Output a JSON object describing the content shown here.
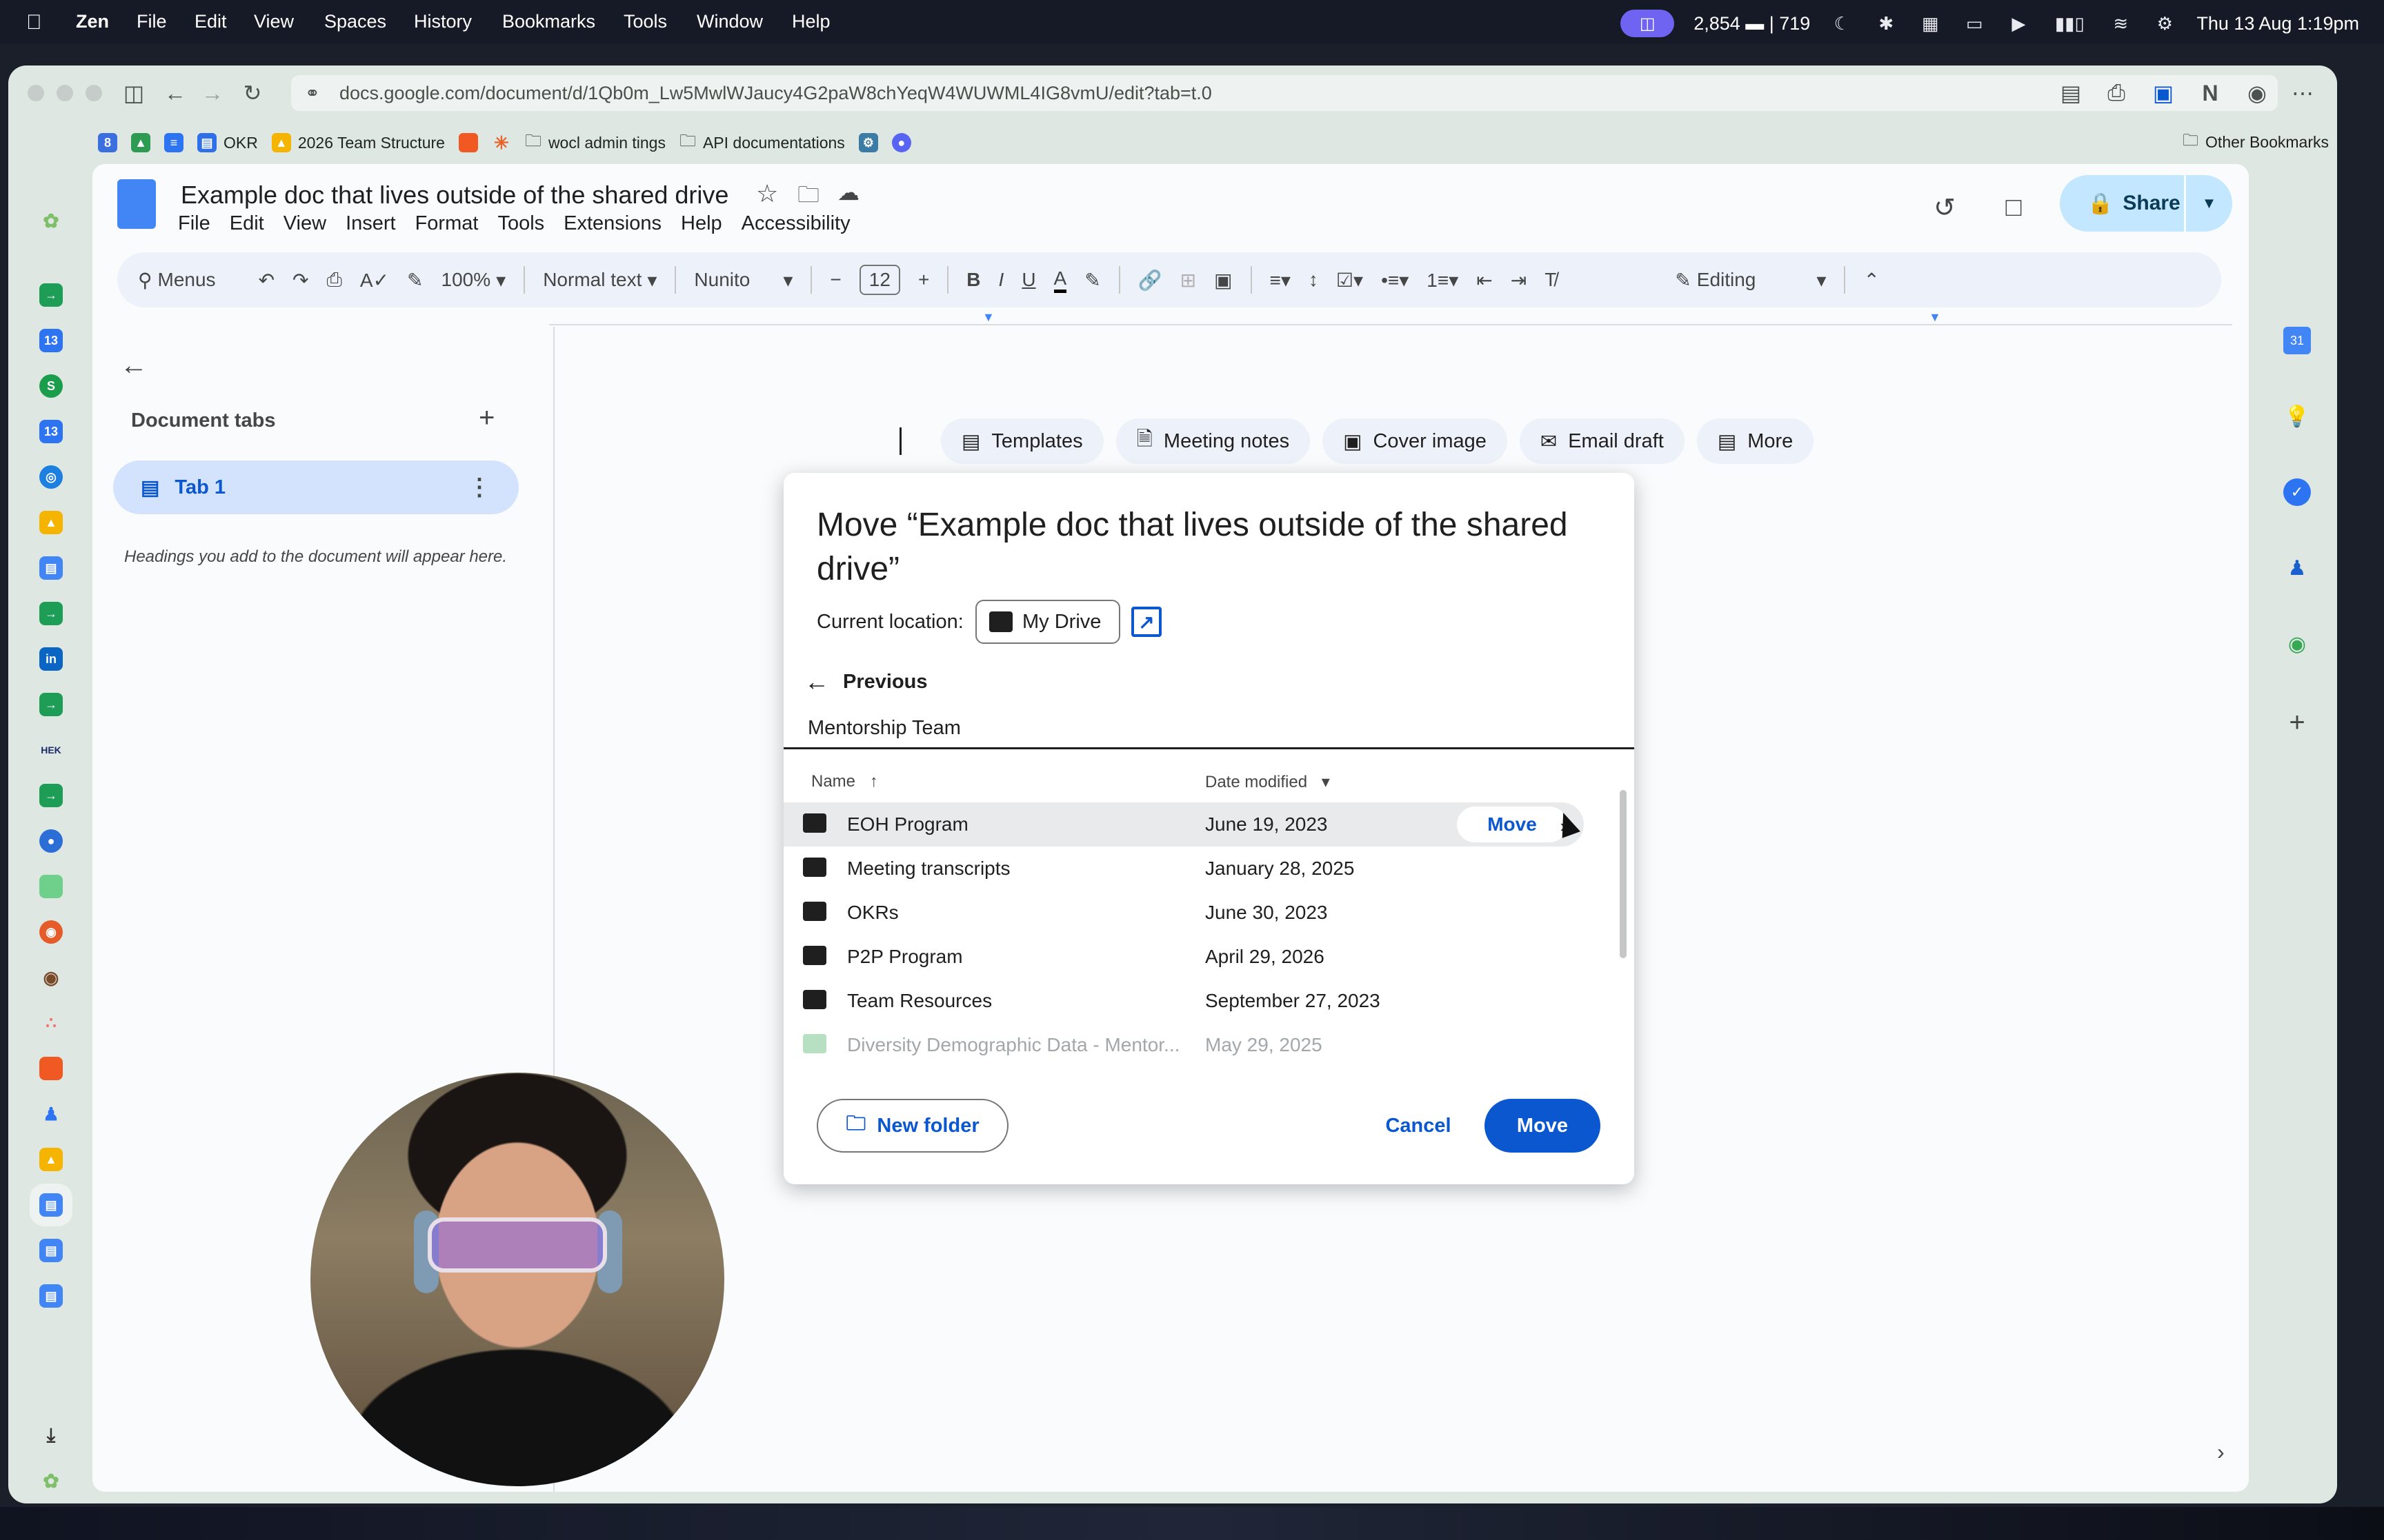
{
  "menubar": {
    "app": "Zen",
    "items": [
      "File",
      "Edit",
      "View",
      "Spaces",
      "History",
      "Bookmarks",
      "Tools",
      "Window",
      "Help"
    ],
    "stats": "2,854 ▬ | 719",
    "datetime": "Thu 13 Aug  1:19pm"
  },
  "browser": {
    "url": "docs.google.com/document/d/1Qb0m_Lw5MwlWJaucy4G2paW8chYeqW4WUWML4IG8vmU/edit?tab=t.0",
    "bookmarks": [
      "OKR",
      "2026 Team Structure",
      "wocl admin tings",
      "API documentations"
    ],
    "other_bookmarks": "Other Bookmarks"
  },
  "docs": {
    "title": "Example doc that lives outside of the shared drive",
    "menu": [
      "File",
      "Edit",
      "View",
      "Insert",
      "Format",
      "Tools",
      "Extensions",
      "Help",
      "Accessibility"
    ],
    "share_label": "Share",
    "toolbar": {
      "search": "Menus",
      "zoom": "100%",
      "style": "Normal text",
      "font": "Nunito",
      "font_size": "12",
      "mode": "Editing"
    },
    "outline": {
      "title": "Document tabs",
      "tab1": "Tab 1",
      "hint": "Headings you add to the document will appear here."
    },
    "chips": [
      "Templates",
      "Meeting notes",
      "Cover image",
      "Email draft",
      "More"
    ]
  },
  "dialog": {
    "title": "Move “Example doc that lives outside of the shared drive”",
    "current_location_label": "Current location:",
    "current_location": "My Drive",
    "previous": "Previous",
    "path": "Mentorship Team",
    "columns": {
      "name": "Name",
      "date": "Date modified"
    },
    "rows": [
      {
        "name": "EOH Program",
        "date": "June 19, 2023"
      },
      {
        "name": "Meeting transcripts",
        "date": "January 28, 2025"
      },
      {
        "name": "OKRs",
        "date": "June 30, 2023"
      },
      {
        "name": "P2P Program",
        "date": "April 29, 2026"
      },
      {
        "name": "Team Resources",
        "date": "September 27, 2023"
      },
      {
        "name": "Diversity Demographic Data - Mentor...",
        "date": "May 29, 2025"
      }
    ],
    "row_move": "Move",
    "new_folder": "New folder",
    "cancel": "Cancel",
    "move": "Move"
  },
  "colors": {
    "accent": "#0b57d0",
    "share_bg": "#c2e7ff",
    "tab_selected": "#d3e3fd"
  }
}
